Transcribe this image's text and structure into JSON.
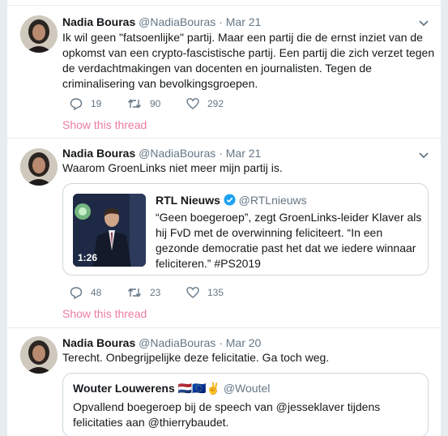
{
  "tweets": [
    {
      "name": "Nadia Bouras",
      "handle": "@NadiaBouras",
      "dot": "·",
      "date": "Mar 21",
      "text": "Ik wil geen \"fatsoenlijke\" partij. Maar een partij die de ernst inziet van de opkomst van een crypto-fascistische partij. Een partij die zich verzet tegen de verdachtmakingen van docenten en journalisten. Tegen de criminalisering van bevolkingsgroepen.",
      "replies": "19",
      "retweets": "90",
      "likes": "292",
      "thread_label": "Show this thread"
    },
    {
      "name": "Nadia Bouras",
      "handle": "@NadiaBouras",
      "dot": "·",
      "date": "Mar 21",
      "text": "Waarom GroenLinks niet meer mijn partij is.",
      "card": {
        "name": "RTL Nieuws",
        "handle": "@RTLnieuws",
        "text": "“Geen boegeroep”, zegt GroenLinks-leider Klaver als hij FvD met de overwinning feliciteert. “In een gezonde democratie past het dat we iedere winnaar feliciteren.” #PS2019",
        "duration": "1:26"
      },
      "replies": "48",
      "retweets": "23",
      "likes": "135",
      "thread_label": "Show this thread"
    },
    {
      "name": "Nadia Bouras",
      "handle": "@NadiaBouras",
      "dot": "·",
      "date": "Mar 20",
      "text": "Terecht. Onbegrijpelijke deze felicitatie. Ga toch weg.",
      "quote": {
        "name": "Wouter Louwerens",
        "emoji": "🇳🇱🇪🇺✌",
        "handle": "@Woutel",
        "text": "Opvallend boegeroep bij de speech van @jesseklaver tijdens felicitaties aan @thierrybaudet."
      }
    }
  ],
  "icons": {
    "reply": "reply-icon",
    "retweet": "retweet-icon",
    "like": "heart-icon",
    "caret": "chevron-down-icon",
    "verified": "verified-badge-icon"
  },
  "colors": {
    "thread_link": "#e0245e",
    "verified": "#1da1f2",
    "muted": "#657786"
  }
}
